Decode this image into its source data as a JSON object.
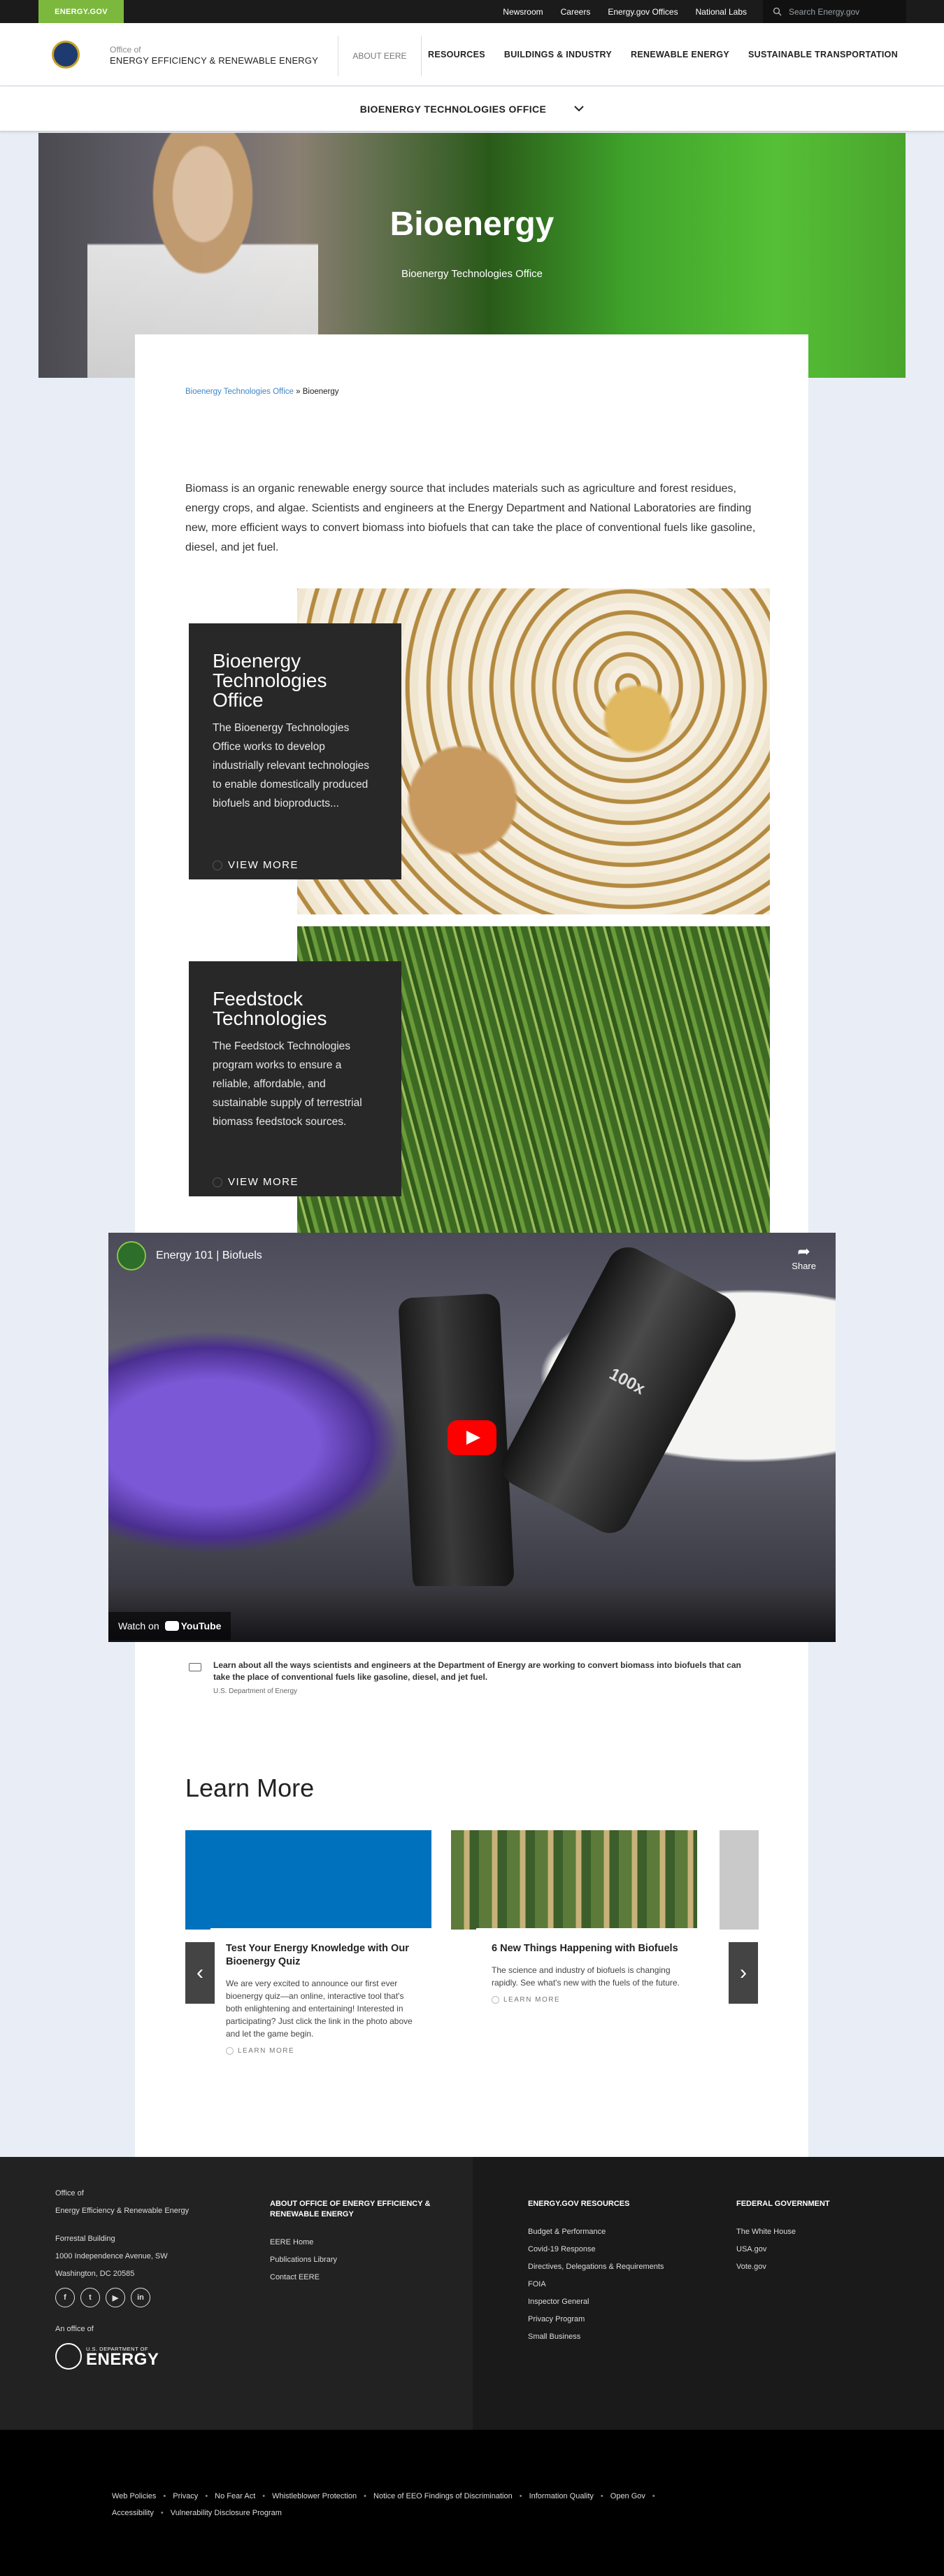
{
  "utility": {
    "badge": "ENERGY.GOV",
    "links": [
      "Newsroom",
      "Careers",
      "Energy.gov Offices",
      "National Labs"
    ],
    "search_placeholder": "Search Energy.gov"
  },
  "header": {
    "office_small": "Office of",
    "office_name": "ENERGY EFFICIENCY & RENEWABLE ENERGY",
    "about": "ABOUT EERE",
    "nav": [
      "RESOURCES",
      "BUILDINGS & INDUSTRY",
      "RENEWABLE ENERGY",
      "SUSTAINABLE TRANSPORTATION"
    ]
  },
  "subbar": {
    "label": "BIOENERGY TECHNOLOGIES OFFICE"
  },
  "hero": {
    "title": "Bioenergy",
    "subtitle": "Bioenergy Technologies Office"
  },
  "breadcrumb": {
    "link": "Bioenergy Technologies Office",
    "sep": " » ",
    "current": "Bioenergy"
  },
  "intro": "Biomass is an organic renewable energy source that includes materials such as agriculture and forest residues, energy crops, and algae. Scientists and engineers at the Energy Department and National Laboratories are finding new, more efficient ways to convert biomass into biofuels that can take the place of conventional fuels like gasoline, diesel, and jet fuel.",
  "features": [
    {
      "title": "Bioenergy Technologies Office",
      "text": "The Bioenergy Technologies Office works to develop industrially relevant technologies to enable domestically produced biofuels and bioproducts...",
      "more": "VIEW MORE"
    },
    {
      "title": "Feedstock Technologies",
      "text": "The Feedstock Technologies program works to ensure a reliable, affordable, and sustainable supply of terrestrial biomass feedstock sources.",
      "more": "VIEW MORE"
    }
  ],
  "video": {
    "title": "Energy 101 | Biofuels",
    "share": "Share",
    "watch_on": "Watch on",
    "youtube": "YouTube",
    "lens_label": "100x",
    "caption": "Learn about all the ways scientists and engineers at the Department of Energy are working to convert biomass into biofuels that can take the place of conventional fuels like gasoline, diesel, and jet fuel.",
    "credit": "U.S. Department of Energy"
  },
  "learn_more": {
    "heading": "Learn More",
    "cards": [
      {
        "title": "Test Your Energy Knowledge with Our Bioenergy Quiz",
        "text": "We are very excited to announce our first ever bioenergy quiz—an online, interactive tool that's both enlightening and entertaining! Interested in participating? Just click the link in the photo above and let the game begin.",
        "more": "LEARN MORE"
      },
      {
        "title": "6 New Things Happening with Biofuels",
        "text": "The science and industry of biofuels is changing rapidly. See what's new with the fuels of the future.",
        "more": "LEARN MORE"
      }
    ],
    "prev": "‹",
    "next": "›"
  },
  "footer": {
    "office_of": "Office of",
    "office_name": "Energy Efficiency & Renewable Energy",
    "address": [
      "Forrestal Building",
      "1000 Independence Avenue, SW",
      "Washington, DC 20585"
    ],
    "social": [
      "f",
      "t",
      "▶",
      "in"
    ],
    "an_office_of": "An office of",
    "doe_small": "U.S. DEPARTMENT OF",
    "doe_big": "ENERGY",
    "col1": {
      "heading": "ABOUT OFFICE OF ENERGY EFFICIENCY & RENEWABLE ENERGY",
      "links": [
        "EERE Home",
        "Publications Library",
        "Contact EERE"
      ]
    },
    "col2": {
      "heading": "ENERGY.GOV RESOURCES",
      "links": [
        "Budget & Performance",
        "Covid-19 Response",
        "Directives, Delegations & Requirements",
        "FOIA",
        "Inspector General",
        "Privacy Program",
        "Small Business"
      ]
    },
    "col3": {
      "heading": "FEDERAL GOVERNMENT",
      "links": [
        "The White House",
        "USA.gov",
        "Vote.gov"
      ]
    }
  },
  "legal": {
    "row1": [
      "Web Policies",
      "Privacy",
      "No Fear Act",
      "Whistleblower Protection",
      "Notice of EEO Findings of Discrimination",
      "Information Quality",
      "Open Gov"
    ],
    "row2": [
      "Accessibility",
      "Vulnerability Disclosure Program"
    ]
  }
}
